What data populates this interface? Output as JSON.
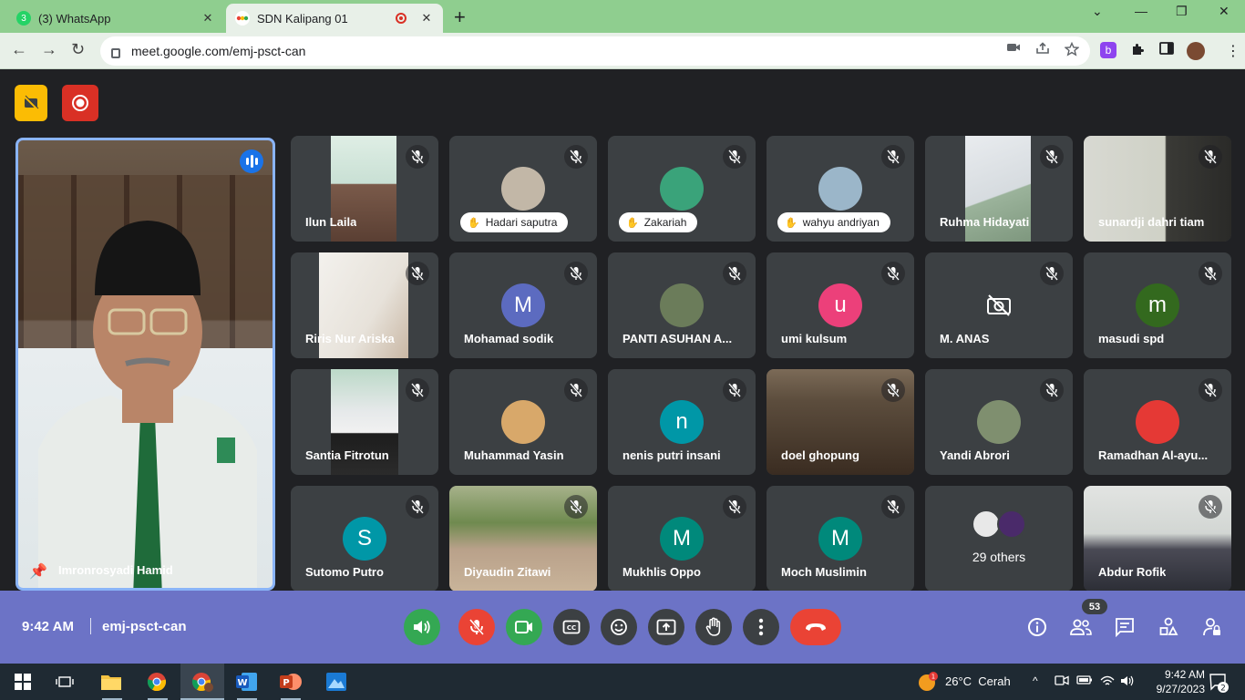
{
  "browser": {
    "tabs": [
      {
        "title": "(3) WhatsApp",
        "badge": "3",
        "favicon_color": "#25d366"
      },
      {
        "title": "SDN Kalipang 01",
        "favicon_color": "#34a853"
      }
    ],
    "new_tab": "+",
    "url": "meet.google.com/emj-psct-can",
    "extension_badge": "b"
  },
  "meet": {
    "speaker": {
      "name": "Imronrosyadi Hamid"
    },
    "tiles": [
      {
        "name": "Ilun Laila",
        "type": "photo"
      },
      {
        "name": "Hadari saputra",
        "type": "hand"
      },
      {
        "name": "Zakariah",
        "type": "hand"
      },
      {
        "name": "wahyu andriyan",
        "type": "hand"
      },
      {
        "name": "Ruhma Hidayati",
        "type": "photo"
      },
      {
        "name": "sunardji dahri tiam",
        "type": "photo"
      },
      {
        "name": "Riris Nur Ariska",
        "type": "photo"
      },
      {
        "name": "Mohamad sodik",
        "type": "letter",
        "letter": "M",
        "color": "#5c6bc0"
      },
      {
        "name": "PANTI ASUHAN A...",
        "type": "avatar"
      },
      {
        "name": "umi kulsum",
        "type": "letter",
        "letter": "u",
        "color": "#ec407a"
      },
      {
        "name": "M. ANAS",
        "type": "cam-off"
      },
      {
        "name": "masudi spd",
        "type": "letter",
        "letter": "m",
        "color": "#33691e"
      },
      {
        "name": "Santia Fitrotun",
        "type": "photo"
      },
      {
        "name": "Muhammad Yasin",
        "type": "avatar"
      },
      {
        "name": "nenis putri insani",
        "type": "letter",
        "letter": "n",
        "color": "#0097a7"
      },
      {
        "name": "doel ghopung",
        "type": "photo"
      },
      {
        "name": "Yandi Abrori",
        "type": "avatar"
      },
      {
        "name": "Ramadhan Al-ayu...",
        "type": "avatar"
      },
      {
        "name": "Sutomo Putro",
        "type": "letter",
        "letter": "S",
        "color": "#0097a7"
      },
      {
        "name": "Diyaudin Zitawi",
        "type": "photo"
      },
      {
        "name": "Mukhlis Oppo",
        "type": "letter",
        "letter": "M",
        "color": "#00897b"
      },
      {
        "name": "Moch Muslimin",
        "type": "letter",
        "letter": "M",
        "color": "#00897b"
      },
      {
        "name": "29 others",
        "type": "others"
      },
      {
        "name": "Abdur Rofik",
        "type": "photo"
      }
    ]
  },
  "controls": {
    "time": "9:42 AM",
    "meeting_code": "emj-psct-can",
    "participants_count": "53",
    "accent_red": "#ea4335",
    "accent_green": "#34a853"
  },
  "taskbar": {
    "weather_temp": "26°C",
    "weather_text": "Cerah",
    "weather_badge": "1",
    "time": "9:42 AM",
    "date": "9/27/2023",
    "notifications": "2"
  }
}
